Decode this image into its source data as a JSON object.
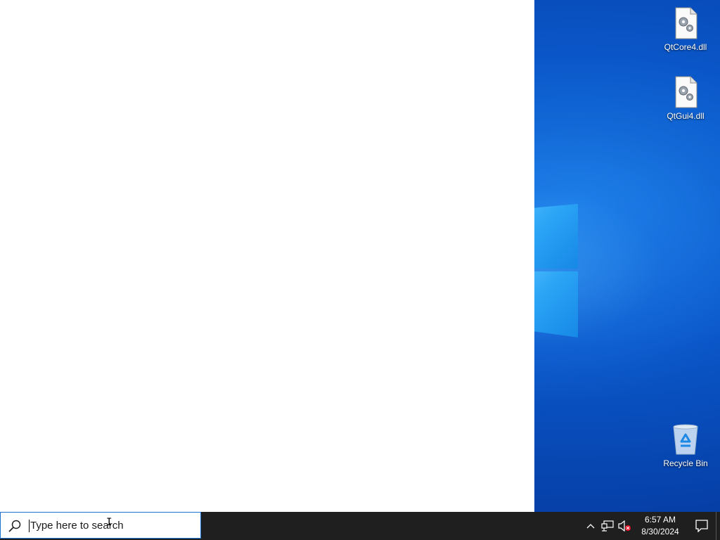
{
  "desktop": {
    "icons": [
      {
        "label": "QtCore4.dll",
        "icon": "dll-file-icon"
      },
      {
        "label": "QtGui4.dll",
        "icon": "dll-file-icon"
      },
      {
        "label": "Recycle Bin",
        "icon": "recycle-bin-icon"
      }
    ]
  },
  "taskbar": {
    "search": {
      "placeholder": "Type here to search"
    },
    "tray": {
      "time": "6:57 AM",
      "date": "8/30/2024"
    }
  }
}
